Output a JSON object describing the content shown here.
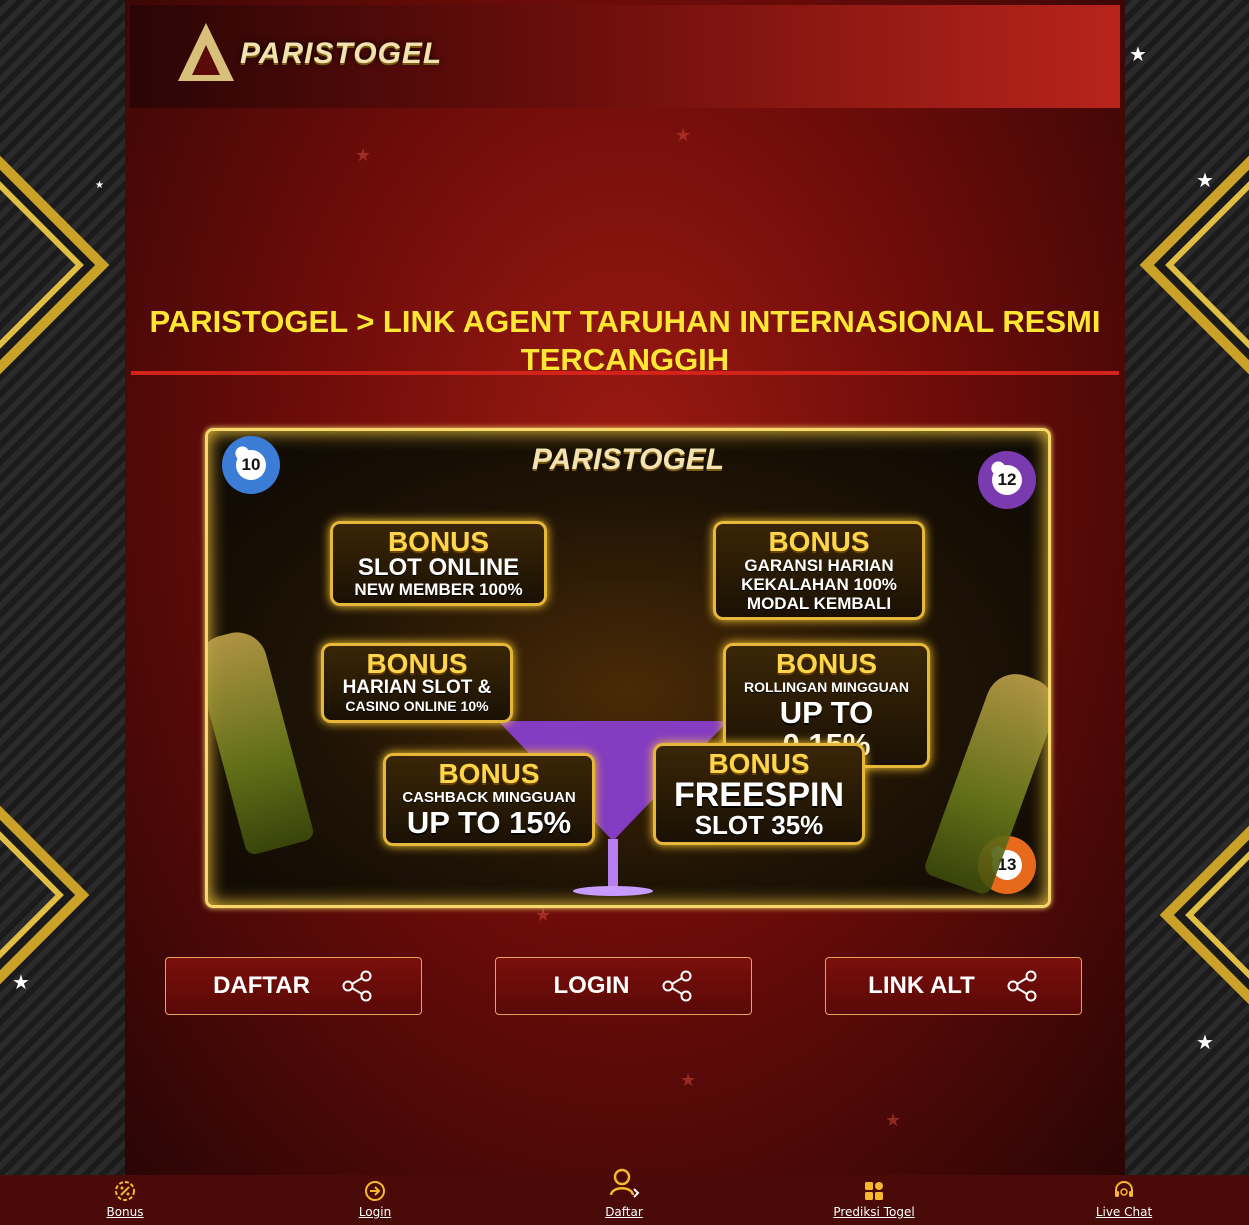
{
  "header": {
    "logo_text": "PARISTOGEL"
  },
  "main": {
    "title": "PARISTOGEL > LINK AGENT TARUHAN INTERNASIONAL RESMI TERCANGGIH"
  },
  "banner": {
    "logo_text": "PARISTOGEL",
    "bonuses": [
      {
        "heading": "BONUS",
        "lines": [
          "SLOT ONLINE",
          "NEW MEMBER 100%"
        ]
      },
      {
        "heading": "BONUS",
        "lines": [
          "GARANSI HARIAN",
          "KEKALAHAN 100%",
          "MODAL KEMBALI"
        ]
      },
      {
        "heading": "BONUS",
        "lines": [
          "HARIAN SLOT &",
          "CASINO ONLINE 10%"
        ]
      },
      {
        "heading": "BONUS",
        "lines": [
          "ROLLINGAN MINGGUAN",
          "UP TO 0,15%"
        ]
      },
      {
        "heading": "BONUS",
        "lines": [
          "CASHBACK MINGGUAN",
          "UP TO 15%"
        ]
      },
      {
        "heading": "BONUS",
        "lines": [
          "FREESPIN",
          "SLOT 35%"
        ]
      }
    ],
    "balls": [
      "10",
      "12",
      "13"
    ]
  },
  "actions": {
    "daftar_label": "DAFTAR",
    "login_label": "LOGIN",
    "link_alt_label": "LINK ALT",
    "icon": "share-icon"
  },
  "bottom_nav": [
    {
      "label": "Bonus",
      "icon": "percent-badge-icon"
    },
    {
      "label": "Login",
      "icon": "arrow-circle-icon"
    },
    {
      "label": "Daftar",
      "icon": "user-add-icon"
    },
    {
      "label": "Prediksi Togel",
      "icon": "grid-icon"
    },
    {
      "label": "Live Chat",
      "icon": "headset-icon"
    }
  ],
  "colors": {
    "title": "#ffe733",
    "divider": "#d4231b",
    "button_border": "#e3a55a",
    "bottom_bar": "#4a0a08",
    "nav_icon": "#f5b82e"
  }
}
